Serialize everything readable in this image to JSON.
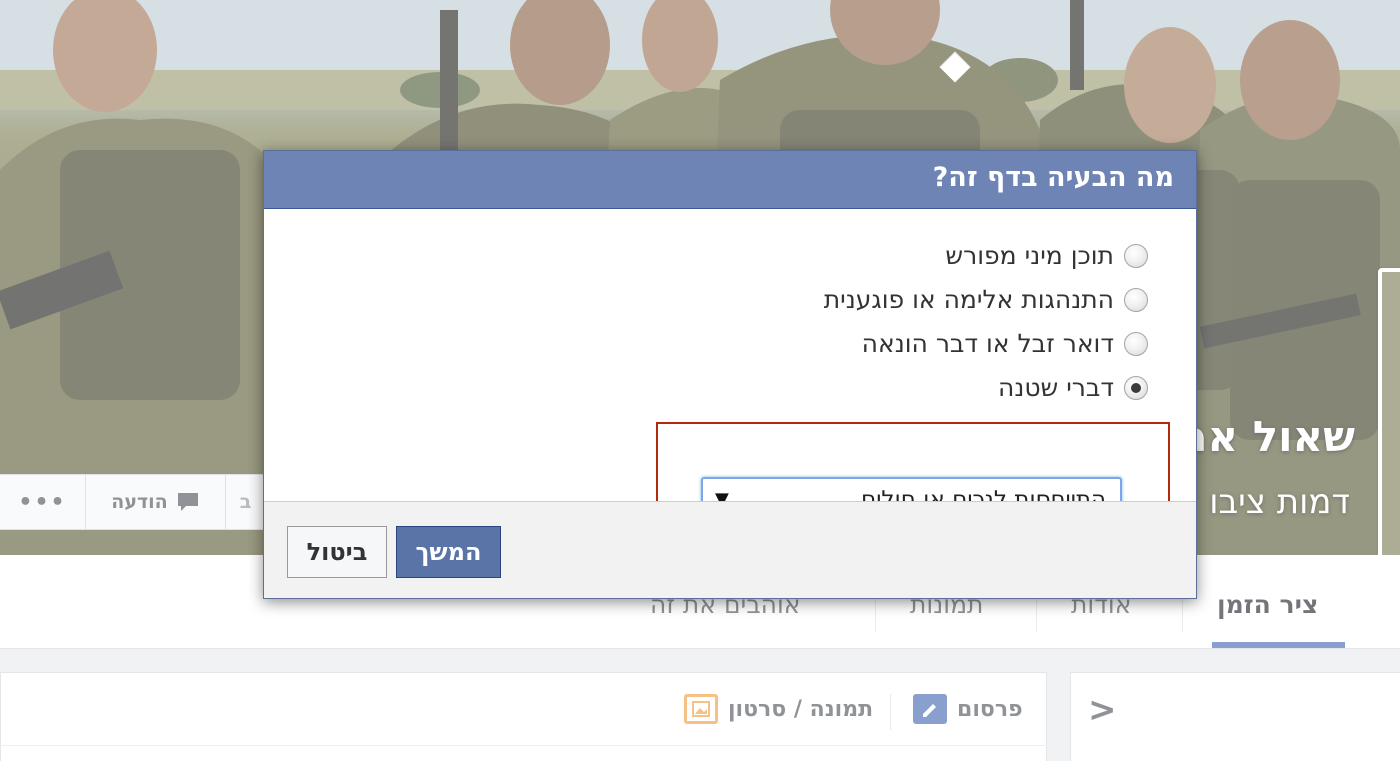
{
  "dialog": {
    "title": "מה הבעיה בדף זה?",
    "options": [
      {
        "label": "תוכן מיני מפורש",
        "selected": false
      },
      {
        "label": "התנהגות אלימה או פוגענית",
        "selected": false
      },
      {
        "label": "דואר זבל או דבר הונאה",
        "selected": false
      },
      {
        "label": "דברי שטנה",
        "selected": true
      }
    ],
    "dropdown_value": "התייחסות לנכים או חולים",
    "dropdown_arrow": "▼",
    "continue_label": "המשך",
    "cancel_label": "ביטול",
    "header_color": "#6d84b4",
    "highlight_color": "#b12b10"
  },
  "page": {
    "name_partial": "שאול אר",
    "category_partial": "דמות ציבו",
    "actions": {
      "more_label": "•••",
      "message_label": "הודעה",
      "partial_label": "ב"
    },
    "tabs": [
      {
        "label": "ציר הזמן",
        "active": true
      },
      {
        "label": "אודות",
        "active": false
      },
      {
        "label": "תמונות",
        "active": false
      },
      {
        "label": "אוהבים את זה",
        "active": false
      }
    ],
    "composer": {
      "post_label": "פרסום",
      "photo_label": "תמונה / סרטון"
    },
    "side_arrow": "<",
    "accent_color": "#4267b2"
  }
}
